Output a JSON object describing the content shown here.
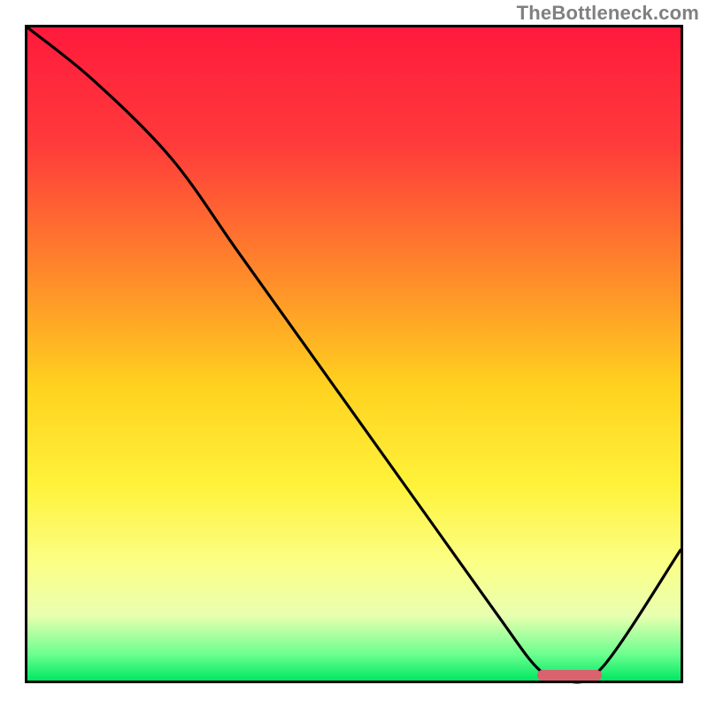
{
  "attribution": "TheBottleneck.com",
  "colors": {
    "gradient_stops": [
      {
        "pct": 0,
        "color": "#ff1a3c"
      },
      {
        "pct": 18,
        "color": "#ff3b3b"
      },
      {
        "pct": 38,
        "color": "#ff8a2a"
      },
      {
        "pct": 55,
        "color": "#ffd21f"
      },
      {
        "pct": 70,
        "color": "#fff23a"
      },
      {
        "pct": 82,
        "color": "#fbff86"
      },
      {
        "pct": 90,
        "color": "#e9ffb0"
      },
      {
        "pct": 96,
        "color": "#6bff8f"
      },
      {
        "pct": 100,
        "color": "#00e862"
      }
    ],
    "curve": "#000000",
    "target_bar": "#d9626e",
    "border": "#000000"
  },
  "chart_data": {
    "type": "line",
    "title": "",
    "xlabel": "",
    "ylabel": "",
    "xlim": [
      0,
      100
    ],
    "ylim": [
      0,
      100
    ],
    "series": [
      {
        "name": "bottleneck-curve",
        "x": [
          0,
          10,
          22,
          32,
          42,
          52,
          62,
          72,
          78,
          82,
          88,
          100
        ],
        "y": [
          100,
          92,
          80,
          66,
          52,
          38,
          24,
          10,
          2,
          0,
          2,
          20
        ]
      }
    ],
    "target_range": {
      "x_start": 78,
      "x_end": 88,
      "y": 0.8
    }
  }
}
